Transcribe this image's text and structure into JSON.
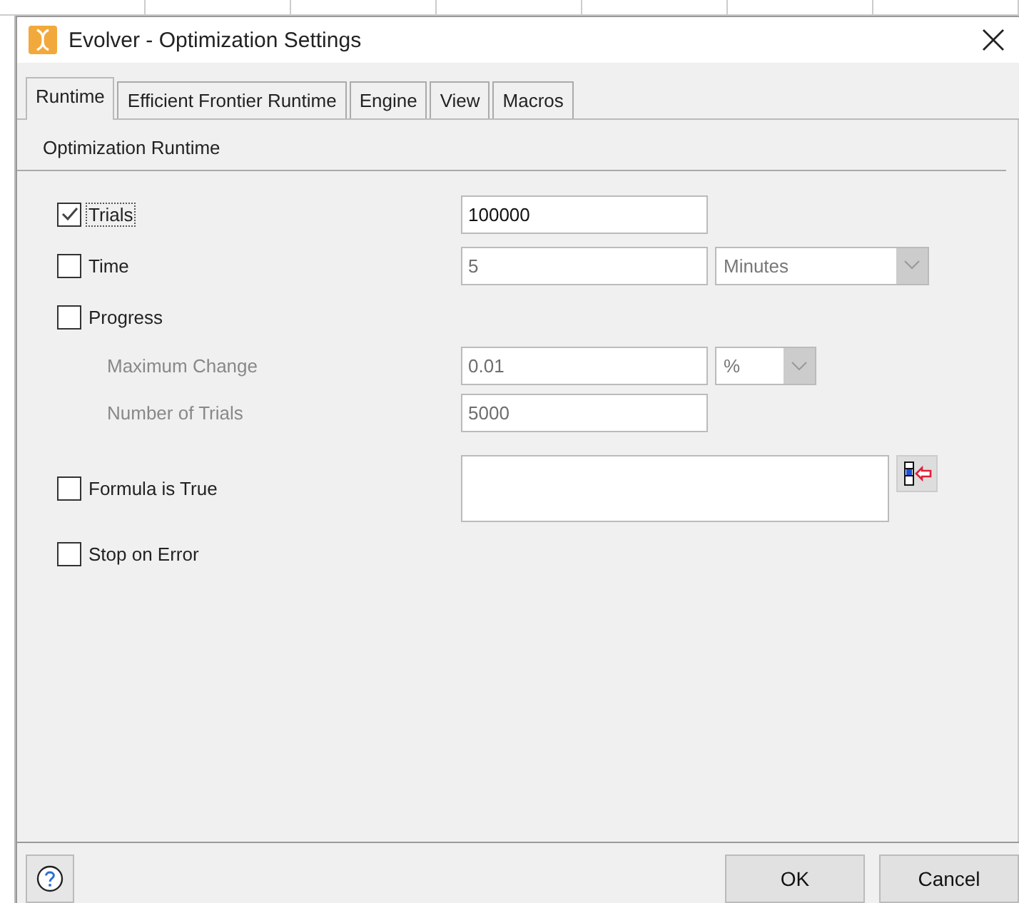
{
  "window": {
    "title": "Evolver - Optimization Settings"
  },
  "tabs": [
    {
      "label": "Runtime",
      "selected": true
    },
    {
      "label": "Efficient Frontier Runtime",
      "selected": false
    },
    {
      "label": "Engine",
      "selected": false
    },
    {
      "label": "View",
      "selected": false
    },
    {
      "label": "Macros",
      "selected": false
    }
  ],
  "section_title": "Optimization Runtime",
  "rows": [
    {
      "kind": "checkbox",
      "label": "Trials",
      "checked": true,
      "field": {
        "value": "100000",
        "disabled": false
      }
    },
    {
      "kind": "checkbox",
      "label": "Time",
      "checked": false,
      "field": {
        "value": "5",
        "disabled": true
      },
      "unit": {
        "value": "Minutes",
        "disabled": true
      }
    },
    {
      "kind": "checkbox",
      "label": "Progress",
      "checked": false
    },
    {
      "kind": "sublabel",
      "label": "Maximum Change",
      "disabled": true,
      "field": {
        "value": "0.01",
        "disabled": true
      },
      "unit": {
        "value": "%",
        "disabled": true
      }
    },
    {
      "kind": "sublabel",
      "label": "Number of Trials",
      "disabled": true,
      "field": {
        "value": "5000",
        "disabled": true
      }
    },
    {
      "kind": "formula",
      "label": "Formula is True",
      "checked": false
    },
    {
      "kind": "checkbox",
      "label": "Stop on Error",
      "checked": false
    }
  ],
  "buttons": [
    "OK",
    "Cancel"
  ]
}
